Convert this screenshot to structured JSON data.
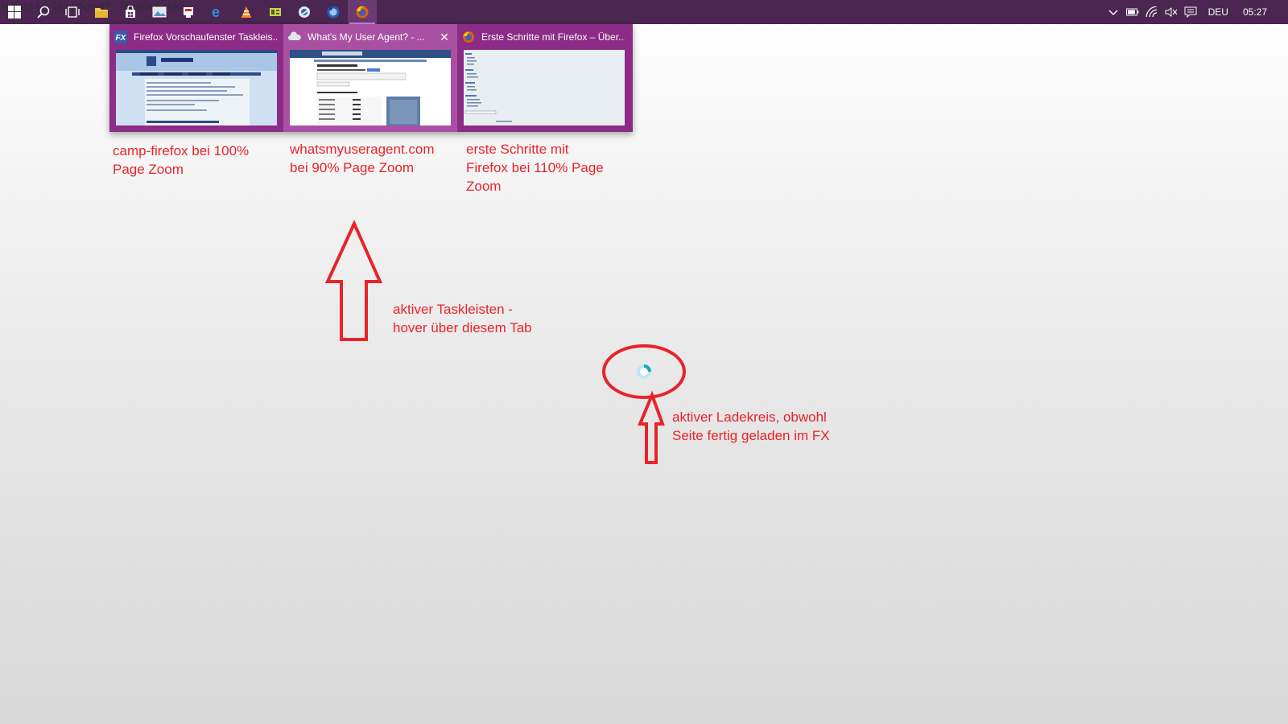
{
  "taskbar": {
    "background_window_title": "What's My User Agent? - Mozilla Firefox",
    "buttons": [
      {
        "name": "start-button",
        "icon": "windows-logo-icon"
      },
      {
        "name": "search-button",
        "icon": "search-icon"
      },
      {
        "name": "task-view-button",
        "icon": "task-view-icon"
      },
      {
        "name": "taskbar-file-explorer",
        "icon": "folder-icon"
      },
      {
        "name": "taskbar-store",
        "icon": "store-icon"
      },
      {
        "name": "taskbar-photos",
        "icon": "photos-icon"
      },
      {
        "name": "taskbar-app-red",
        "icon": "app-icon"
      },
      {
        "name": "taskbar-edge",
        "icon": "edge-icon"
      },
      {
        "name": "taskbar-vlc",
        "icon": "vlc-icon"
      },
      {
        "name": "taskbar-app-green",
        "icon": "app-icon"
      },
      {
        "name": "taskbar-app-globe",
        "icon": "globe-icon"
      },
      {
        "name": "taskbar-firefox-dev",
        "icon": "firefox-dev-icon"
      },
      {
        "name": "taskbar-firefox",
        "icon": "firefox-icon",
        "active": true
      }
    ],
    "tray": {
      "language": "DEU",
      "clock": "05:27"
    }
  },
  "previews": [
    {
      "title": "Firefox Vorschaufenster Taskleis...",
      "icon": "fx-forum-icon",
      "hover": false
    },
    {
      "title": "What's My User Agent? - ...",
      "icon": "cloud-icon",
      "hover": true,
      "close": "✕"
    },
    {
      "title": "Erste Schritte mit Firefox – Über...",
      "icon": "firefox-icon",
      "hover": false
    }
  ],
  "annotations": {
    "caption_1_line1": "camp-firefox bei 100%",
    "caption_1_line2": "Page Zoom",
    "caption_2_line1": "whatsmyuseragent.com",
    "caption_2_line2": "bei 90% Page Zoom",
    "caption_3_line1": "erste Schritte mit",
    "caption_3_line2": "Firefox bei 110% Page",
    "caption_3_line3": "Zoom",
    "hover_note_line1": "aktiver Taskleisten -",
    "hover_note_line2": "hover über diesem Tab",
    "spinner_note_line1": "aktiver Ladekreis, obwohl",
    "spinner_note_line2": "Seite fertig geladen im FX"
  },
  "colors": {
    "taskbar": "#4a2650",
    "preview_bg": "#8c2c86",
    "annotation_red": "#e8232a"
  }
}
